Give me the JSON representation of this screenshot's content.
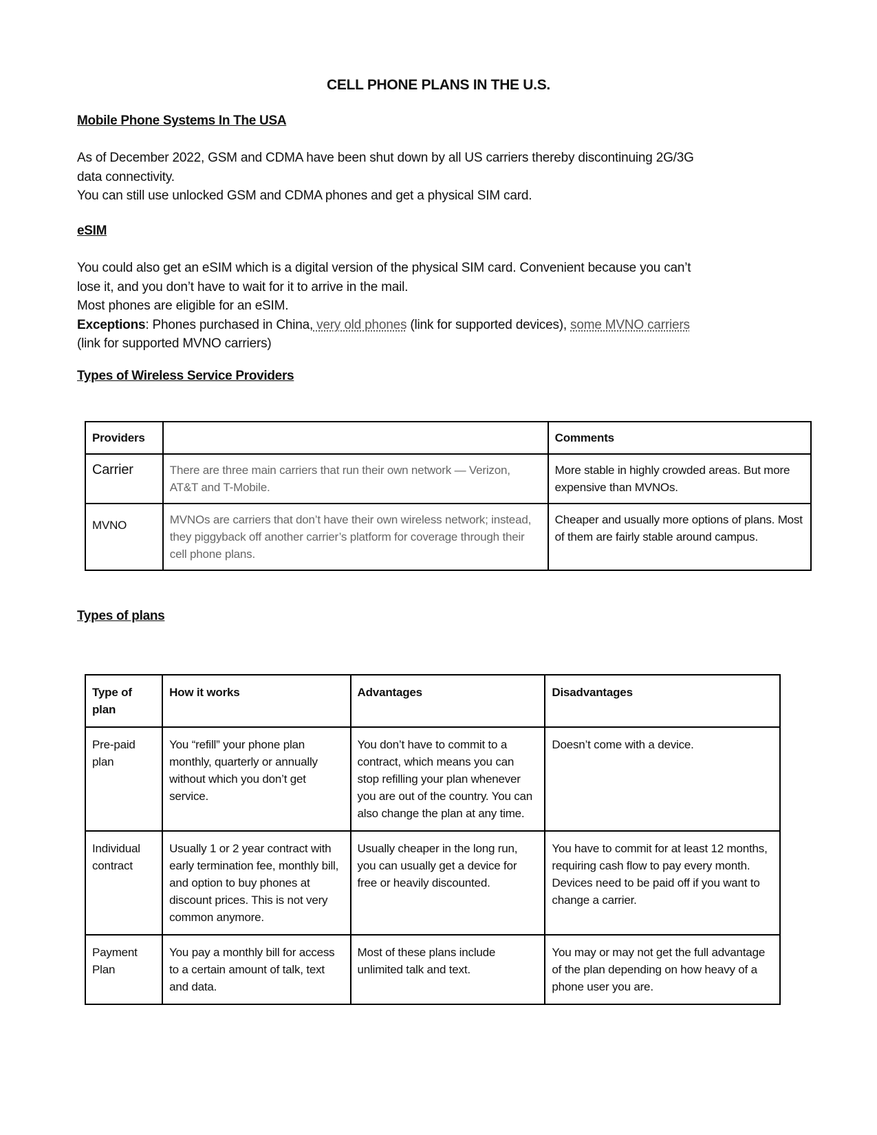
{
  "document": {
    "title": "CELL PHONE PLANS IN THE U.S.",
    "sections": {
      "mobile_systems": {
        "heading": "Mobile Phone Systems In The USA",
        "lines": [
          "As of December 2022, GSM and CDMA have been shut down by all US carriers thereby discontinuing 2G/3G",
          "data connectivity.",
          "You can still use unlocked GSM and CDMA phones and get a physical SIM card."
        ]
      },
      "esim": {
        "heading": "eSIM",
        "lines": [
          "You could also get an eSIM which is a digital version of the physical SIM card. Convenient because you can’t",
          "lose it, and you don’t have to wait for it to arrive in the mail.",
          "Most phones are eligible for an eSIM."
        ],
        "exceptions_label": "Exceptions",
        "exceptions_text_1": ": Phones purchased in China,",
        "link_1": " very old phones",
        "exceptions_text_2": " (link for supported devices), ",
        "link_2": "some MVNO carriers",
        "exceptions_text_3": "(link for supported MVNO carriers)"
      },
      "providers": {
        "heading": "Types of Wireless Service Providers",
        "columns": [
          "Providers",
          "",
          "Comments"
        ],
        "rows": [
          {
            "provider": "Carrier",
            "description": "There are three main carriers that run their own network — Verizon, AT&T and T-Mobile.",
            "comments": "More stable in highly crowded areas. But more expensive than MVNOs."
          },
          {
            "provider": "MVNO",
            "description": "MVNOs are carriers that don’t have their own wireless network; instead, they piggyback off another carrier’s platform for coverage through their cell phone plans.",
            "comments": "Cheaper and usually more options of plans. Most of them are fairly stable around campus."
          }
        ]
      },
      "plans": {
        "heading": "Types of plans",
        "columns": [
          "Type of plan",
          "How it works",
          "Advantages",
          "Disadvantages"
        ],
        "rows": [
          {
            "type": "Pre-paid plan",
            "how": "You “refill” your phone plan monthly, quarterly or annually without which you don’t get service.",
            "advantages": "You don’t have to commit to a contract, which means you can stop refilling your plan whenever you are out of the country. You can also change the plan at any time.",
            "disadvantages": "Doesn’t come with a device."
          },
          {
            "type": "Individual contract",
            "how": "Usually 1 or 2 year contract with early termination fee, monthly bill, and option to buy phones at discount prices. This is not very common anymore.",
            "advantages": "Usually cheaper in the long run, you can usually get a device for free or heavily discounted.",
            "disadvantages": "You have to commit for at least 12 months, requiring cash flow to pay every month. Devices need to be paid off if you want to change a carrier."
          },
          {
            "type": "Payment Plan",
            "how": "You pay a monthly bill for access to a certain amount of talk, text and data.",
            "advantages": "Most of these plans include unlimited talk and text.",
            "disadvantages": "You may or may not get the full advantage of the plan depending on how heavy of a phone user you are."
          }
        ]
      }
    }
  }
}
